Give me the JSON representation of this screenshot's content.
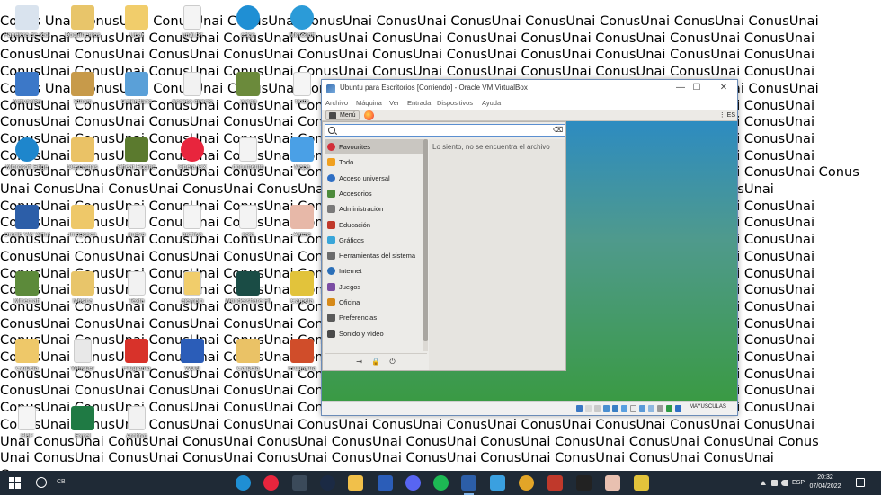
{
  "wallpaper": {
    "lines": [
      "Conus Unai ConusUnai ConusUnai ConusUnai ConusUnai ConusUnai ConusUnai ConusUnai ConusUnai ConusUnai ConusUnai",
      "ConusUnai ConusUnai ConusUnai ConusUnai ConusUnai ConusUnai ConusUnai ConusUnai ConusUnai ConusUnai ConusUnai",
      "ConusUnai ConusUnai ConusUnai ConusUnai ConusUnai ConusUnai ConusUnai ConusUnai ConusUnai ConusUnai ConusUnai",
      "ConusUnai ConusUnai ConusUnai ConusUnai ConusUnai ConusUnai ConusUnai ConusUnai ConusUnai ConusUnai ConusUnai",
      "Conus Unai ConusUnai ConusUnai ConusUnai ConusUnai ConusUnai ConusUnai ConusUnai ConusUnai ConusUnai ConusUnai",
      "ConusUnai ConusUnai ConusUnai ConusUnai ConusUnai ConusUnai ConusUnai ConusUnai ConusUnai ConusUnai ConusUnai",
      "ConusUnai ConusUnai ConusUnai ConusUnai ConusUnai ConusUnai ConusUnai ConusUnai ConusUnai ConusUnai ConusUnai",
      "ConusUnai ConusUnai ConusUnai ConusUnai ConusUnai ConusUnai ConusUnai ConusUnai ConusUnai ConusUnai ConusUnai",
      "ConusUnai ConusUnai ConusUnai ConusUnai ConusUnai ConusUnai ConusUnai ConusUnai ConusUnai ConusUnai ConusUnai",
      "ConusUnai ConusUnai ConusUnai ConusUnai ConusUnai ConusUnai ConusUnai ConusUnai ConusUnai ConusUnai ConusUnai Conus",
      "Unai ConusUnai ConusUnai ConusUnai ConusUnai ConusUnai ConusUnai ConusUnai ConusUnai ConusUnai ConusUnai",
      "ConusUnai ConusUnai ConusUnai ConusUnai ConusUnai ConusUnai ConusUnai ConusUnai ConusUnai ConusUnai ConusUnai",
      "ConusUnai ConusUnai ConusUnai ConusUnai ConusUnai ConusUnai ConusUnai ConusUnai ConusUnai ConusUnai ConusUnai",
      "ConusUnai ConusUnai ConusUnai ConusUnai ConusUnai ConusUnai ConusUnai ConusUnai ConusUnai ConusUnai ConusUnai",
      "ConusUnai ConusUnai ConusUnai ConusUnai ConusUnai ConusUnai ConusUnai ConusUnai ConusUnai ConusUnai ConusUnai",
      "ConusUnai ConusUnai ConusUnai ConusUnai ConusUnai ConusUnai ConusUnai ConusUnai ConusUnai ConusUnai ConusUnai",
      "ConusUnai ConusUnai ConusUnai ConusUnai ConusUnai ConusUnai ConusUnai ConusUnai ConusUnai ConusUnai ConusUnai",
      "ConusUnai ConusUnai ConusUnai ConusUnai ConusUnai ConusUnai ConusUnai ConusUnai ConusUnai ConusUnai ConusUnai",
      "ConusUnai ConusUnai ConusUnai ConusUnai ConusUnai ConusUnai ConusUnai ConusUnai ConusUnai ConusUnai ConusUnai",
      "ConusUnai ConusUnai ConusUnai ConusUnai ConusUnai ConusUnai ConusUnai ConusUnai ConusUnai ConusUnai ConusUnai",
      "ConusUnai ConusUnai ConusUnai ConusUnai ConusUnai ConusUnai ConusUnai ConusUnai ConusUnai ConusUnai ConusUnai",
      "ConusUnai ConusUnai ConusUnai ConusUnai ConusUnai ConusUnai ConusUnai ConusUnai ConusUnai ConusUnai ConusUnai",
      "ConusUnai ConusUnai ConusUnai ConusUnai ConusUnai ConusUnai ConusUnai ConusUnai ConusUnai ConusUnai ConusUnai",
      "ConusUnai ConusUnai ConusUnai ConusUnai ConusUnai ConusUnai ConusUnai ConusUnai ConusUnai ConusUnai ConusUnai",
      "ConusUnai ConusUnai ConusUnai ConusUnai ConusUnai ConusUnai ConusUnai ConusUnai ConusUnai ConusUnai ConusUnai",
      "Unai ConusUnai ConusUnai ConusUnai ConusUnai ConusUnai ConusUnai ConusUnai ConusUnai ConusUnai ConusUnai Conus",
      "Unai ConusUnai ConusUnai ConusUnai ConusUnai ConusUnai ConusUnai ConusUnai ConusUnai ConusUnai ConusUnai",
      "Conus"
    ]
  },
  "desktop_icons": [
    {
      "name": "recycle-bin",
      "label": "Papelera de reciclaje",
      "color": "#d9e3ee"
    },
    {
      "name": "folder",
      "label": "Documentos",
      "color": "#e8c56a"
    },
    {
      "name": "folder",
      "label": "Unai",
      "color": "#f1cd6b"
    },
    {
      "name": "file",
      "label": "unai.txt",
      "color": "#f4f4f4"
    },
    {
      "name": "edge",
      "label": "edge",
      "color": "#1f8fd4"
    },
    {
      "name": "edge",
      "label": "Microsoft",
      "color": "#2b9bd8"
    },
    {
      "name": "setup",
      "label": "Activación",
      "color": "#3c78c8"
    },
    {
      "name": "app",
      "label": "Steam",
      "color": "#c79a4a"
    },
    {
      "name": "app",
      "label": "Calendario",
      "color": "#5aa0d8"
    },
    {
      "name": "file",
      "label": "Acceso directo",
      "color": "#f2f2f2"
    },
    {
      "name": "app",
      "label": "Juego",
      "color": "#6b8a3b"
    },
    {
      "name": "file",
      "label": "texto",
      "color": "#f5f5f5"
    },
    {
      "name": "edge",
      "label": "Microsoft Edge",
      "color": "#1e86cc"
    },
    {
      "name": "folder",
      "label": "Descargas",
      "color": "#eac266"
    },
    {
      "name": "app",
      "label": "Cheat Engine",
      "color": "#5b7a2e"
    },
    {
      "name": "opera",
      "label": "Opera GX",
      "color": "#e8253d"
    },
    {
      "name": "file",
      "label": "documento",
      "color": "#f3f3f3"
    },
    {
      "name": "app",
      "label": "Mapa",
      "color": "#4aa0e6"
    },
    {
      "name": "virtualbox",
      "label": "Oracle VM VirtualBox",
      "color": "#2c5ea8"
    },
    {
      "name": "folder",
      "label": "Imágenes",
      "color": "#eec869"
    },
    {
      "name": "file",
      "label": "nuevo",
      "color": "#f2f2f2"
    },
    {
      "name": "file",
      "label": "archivo",
      "color": "#f4f4f4"
    },
    {
      "name": "file",
      "label": "nota",
      "color": "#f3f3f3"
    },
    {
      "name": "app",
      "label": "Anime",
      "color": "#e7b8a8"
    },
    {
      "name": "minecraft",
      "label": "Minecraft",
      "color": "#5c8a3a"
    },
    {
      "name": "folder",
      "label": "Música",
      "color": "#e8c56a"
    },
    {
      "name": "file",
      "label": "Texto",
      "color": "#f2f2f2"
    },
    {
      "name": "file",
      "label": "ejemplo",
      "color": "#f1cd6b"
    },
    {
      "name": "filmora",
      "label": "Wondershare Filmora",
      "color": "#1a4c45"
    },
    {
      "name": "app",
      "label": "Carpeta",
      "color": "#e2c33b"
    },
    {
      "name": "folder",
      "label": "Carpeta",
      "color": "#eec869"
    },
    {
      "name": "file",
      "label": "Whisper",
      "color": "#e8e8e8"
    },
    {
      "name": "app",
      "label": "Programa",
      "color": "#d8322a"
    },
    {
      "name": "word",
      "label": "Word",
      "color": "#2b5db8"
    },
    {
      "name": "folder",
      "label": "Carpeta",
      "color": "#eac266"
    },
    {
      "name": "app",
      "label": "Programa",
      "color": "#d04d2a"
    },
    {
      "name": "pdf",
      "label": "PDF",
      "color": "#f5f5f5"
    },
    {
      "name": "excel",
      "label": "Excel",
      "color": "#1f7a44"
    },
    {
      "name": "file",
      "label": "Archivo",
      "color": "#f2f2f2"
    }
  ],
  "vbox": {
    "title": "Ubuntu para Escritorios [Corriendo] - Oracle VM VirtualBox",
    "minimize": "—",
    "maximize": "☐",
    "close": "✕",
    "menus": [
      "Archivo",
      "Máquina",
      "Ver",
      "Entrada",
      "Dispositivos",
      "Ayuda"
    ],
    "panel": {
      "menu_label": "Menú",
      "lang": "⋮ ES"
    },
    "search": {
      "value": "",
      "placeholder": ""
    },
    "categories": [
      {
        "label": "Favourites",
        "icon": "heart",
        "color": "#d22f3a",
        "selected": true
      },
      {
        "label": "Todo",
        "icon": "all",
        "color": "#f0a020"
      },
      {
        "label": "Acceso universal",
        "icon": "accessibility",
        "color": "#2f6fc4"
      },
      {
        "label": "Accesorios",
        "icon": "accessories",
        "color": "#4c8a3a"
      },
      {
        "label": "Administración",
        "icon": "admin",
        "color": "#7a7a7a"
      },
      {
        "label": "Educación",
        "icon": "education",
        "color": "#c0392b"
      },
      {
        "label": "Gráficos",
        "icon": "graphics",
        "color": "#3aa6d9"
      },
      {
        "label": "Herramientas del sistema",
        "icon": "system",
        "color": "#6b6b6b"
      },
      {
        "label": "Internet",
        "icon": "internet",
        "color": "#2b6fb8"
      },
      {
        "label": "Juegos",
        "icon": "games",
        "color": "#7b4da3"
      },
      {
        "label": "Oficina",
        "icon": "office",
        "color": "#d68a1a"
      },
      {
        "label": "Preferencias",
        "icon": "preferences",
        "color": "#5a5a5a"
      },
      {
        "label": "Sonido y vídeo",
        "icon": "multimedia",
        "color": "#4a4a4a"
      }
    ],
    "no_results": "Lo siento, no se encuentra el archivo",
    "bottom_buttons": [
      "⇥",
      "🔒",
      "⏻"
    ],
    "status_host_key": "MAYUSCULAS"
  },
  "taskbar": {
    "search_text": "CB",
    "apps": [
      {
        "name": "edge",
        "color": "#1f8fd4"
      },
      {
        "name": "opera",
        "color": "#e8253d"
      },
      {
        "name": "app-dark",
        "color": "#3b4a5a"
      },
      {
        "name": "steam",
        "color": "#1b2a44"
      },
      {
        "name": "file-explorer",
        "color": "#f1c04a"
      },
      {
        "name": "word",
        "color": "#2b5db8"
      },
      {
        "name": "discord",
        "color": "#5865f2"
      },
      {
        "name": "spotify",
        "color": "#1db954"
      },
      {
        "name": "virtualbox",
        "color": "#2c5ea8"
      },
      {
        "name": "photos",
        "color": "#3aa0e0"
      },
      {
        "name": "chrome",
        "color": "#e2a528"
      },
      {
        "name": "app-red",
        "color": "#c0392b"
      },
      {
        "name": "epic-games",
        "color": "#222222"
      },
      {
        "name": "app-anime",
        "color": "#e8c0b0"
      },
      {
        "name": "app-yellow",
        "color": "#e2c33b"
      }
    ],
    "lang": "ESP",
    "time": "20:32",
    "date": "07/04/2022"
  }
}
